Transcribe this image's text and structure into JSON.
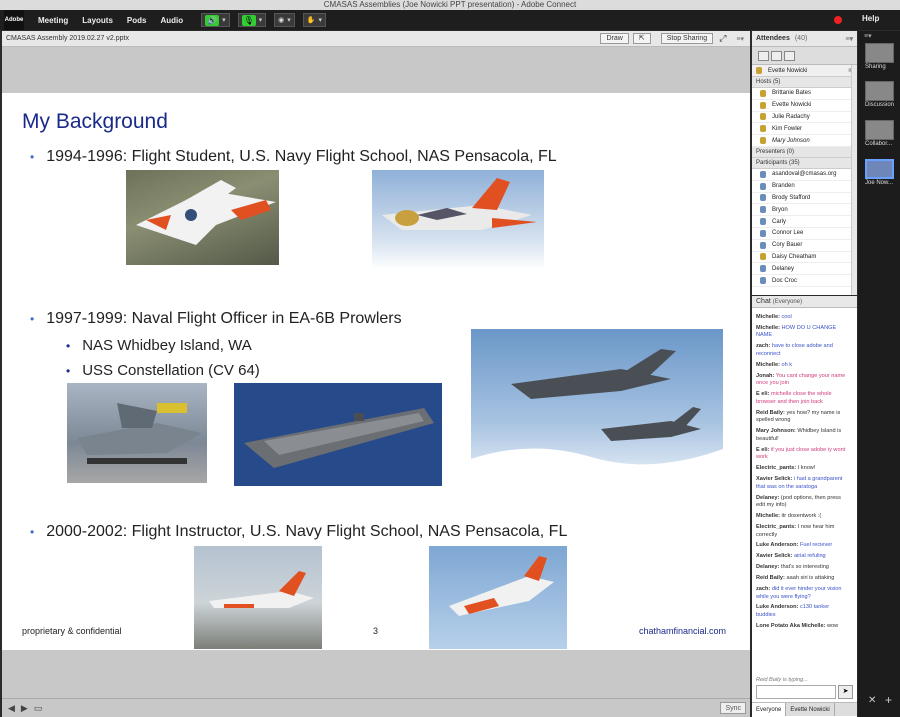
{
  "window": {
    "title": "CMASAS Assemblies (Joe Nowicki PPT presentation) - Adobe Connect"
  },
  "menubar": {
    "logo": "Adobe",
    "items": [
      "Meeting",
      "Layouts",
      "Pods",
      "Audio"
    ],
    "help": "Help"
  },
  "share_pod": {
    "title": "CMASAS Assembly 2019.02.27 v2.pptx",
    "draw": "Draw",
    "stop": "Stop Sharing"
  },
  "slide": {
    "title": "My Background",
    "b1": "1994-1996:  Flight Student, U.S. Navy Flight School, NAS Pensacola, FL",
    "b2": "1997-1999:  Naval Flight Officer in EA-6B Prowlers",
    "b2a": "NAS Whidbey Island, WA",
    "b2b": "USS Constellation (CV 64)",
    "b3": "2000-2002:  Flight Instructor, U.S. Navy Flight School, NAS Pensacola, FL",
    "footer_left": "proprietary & confidential",
    "page": "3",
    "footer_right": "chathamfinancial.com"
  },
  "bottombar": {
    "sync": "Sync"
  },
  "attendees": {
    "title": "Attendees",
    "count": "(40)",
    "me": "Evette Nowicki",
    "hosts_label": "Hosts (5)",
    "hosts": [
      "Brittanie Bates",
      "Evette Nowicki",
      "Julie Radachy",
      "Kim Fowler",
      "Mary Johnson"
    ],
    "presenters_label": "Presenters (0)",
    "participants_label": "Participants (35)",
    "participants": [
      "asandoval@cmasas.org",
      "Branden",
      "Brody Stafford",
      "Bryon",
      "Carly",
      "Connor Lee",
      "Cory Bauer",
      "Daisy Cheatham",
      "Delaney",
      "Doc Croc"
    ]
  },
  "chat": {
    "title": "Chat",
    "scope": "(Everyone)",
    "messages": [
      {
        "name": "Michelle:",
        "text": "cool",
        "color": "blue"
      },
      {
        "name": "Michelle:",
        "text": "HOW DO U CHANGE NAME",
        "color": "blue"
      },
      {
        "name": "zach:",
        "text": "have to close adobe and reconnect",
        "color": "blue"
      },
      {
        "name": "Michelle:",
        "text": "oh k",
        "color": "blue"
      },
      {
        "name": "Jonah:",
        "text": "You cant change your name once you join",
        "color": "pink"
      },
      {
        "name": "E eli:",
        "text": "michelle close the whole browser and then join back",
        "color": "pink"
      },
      {
        "name": "Reid Baily:",
        "text": "yes how? my name is spelled wrong",
        "color": "dark"
      },
      {
        "name": "Mary Johnson:",
        "text": "Whidbey Island is beautiful!",
        "color": "dark"
      },
      {
        "name": "E eli:",
        "text": "if you just close adobe iy wont work",
        "color": "pink"
      },
      {
        "name": "Electric_pants:",
        "text": "I know!",
        "color": "dark"
      },
      {
        "name": "Xavier Selick:",
        "text": "i had a grandparent that was on the saratoga",
        "color": "blue"
      },
      {
        "name": "Delaney:",
        "text": "(pod options, then press edit my info)",
        "color": "dark"
      },
      {
        "name": "Michelle:",
        "text": "itr dosentwork :(",
        "color": "dark"
      },
      {
        "name": "Electric_pants:",
        "text": "I now hear him correctly",
        "color": "dark"
      },
      {
        "name": "Luke Anderson:",
        "text": "Fuel reciever",
        "color": "blue"
      },
      {
        "name": "Xavier Selick:",
        "text": "airial refuling",
        "color": "blue"
      },
      {
        "name": "Delaney:",
        "text": "that's so interesting",
        "color": "dark"
      },
      {
        "name": "Reid Baily:",
        "text": "aaah siri is attaking",
        "color": "dark"
      },
      {
        "name": "zach:",
        "text": "did it ever hinder your vision while you were flying?",
        "color": "blue"
      },
      {
        "name": "Luke Anderson:",
        "text": "c130 tanker buddies",
        "color": "blue"
      },
      {
        "name": "Lone Potato Aka Michelle:",
        "text": "wow",
        "color": "dark"
      }
    ],
    "typing": "Reid Baily is typing...",
    "send": "➤",
    "tabs": [
      "Everyone",
      "Evette Nowicki"
    ]
  },
  "layouts": {
    "items": [
      "Sharing",
      "Discussion",
      "Collabor...",
      "Joe Now..."
    ]
  }
}
